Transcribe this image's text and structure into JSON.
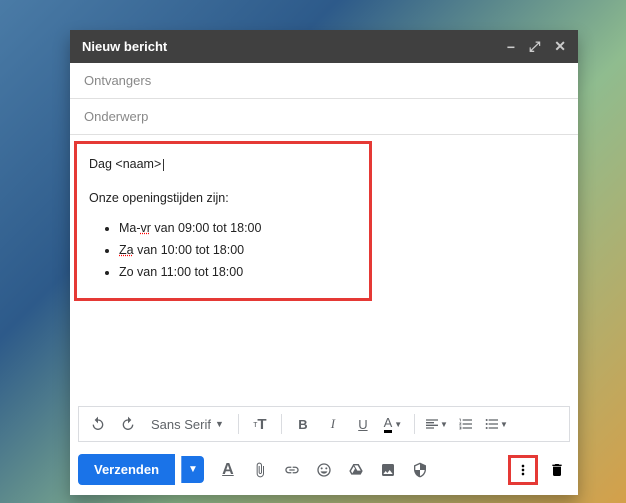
{
  "window": {
    "title": "Nieuw bericht"
  },
  "fields": {
    "recipients_placeholder": "Ontvangers",
    "subject_placeholder": "Onderwerp"
  },
  "body": {
    "greeting_prefix": "Dag ",
    "greeting_token": "<naam>",
    "opening_line": "Onze openingstijden zijn:",
    "hours": [
      {
        "prefix": "Ma-",
        "spell": "vr",
        "rest": " van 09:00 tot 18:00"
      },
      {
        "prefix": "",
        "spell": "Za",
        "rest": " van 10:00 tot 18:00"
      },
      {
        "prefix": "Zo van 11:00 tot 18:00",
        "spell": "",
        "rest": ""
      }
    ]
  },
  "format_toolbar": {
    "font_name": "Sans Serif"
  },
  "send": {
    "label": "Verzenden"
  }
}
